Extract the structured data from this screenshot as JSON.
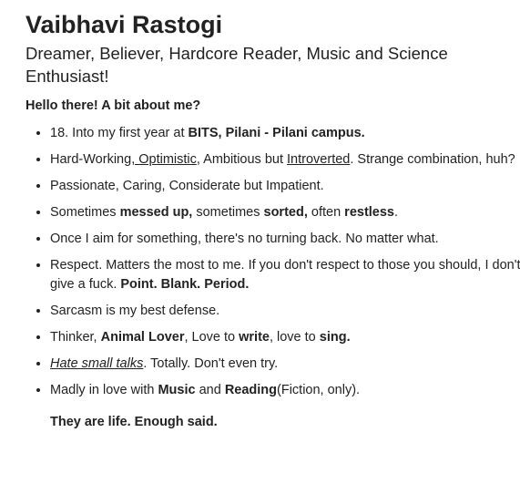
{
  "profile": {
    "name": "Vaibhavi Rastogi",
    "tagline": "Dreamer, Believer, Hardcore Reader, Music and Science Enthusiast!",
    "intro": "Hello there! A bit about me?",
    "closing": "They are life. Enough said."
  },
  "facts": {
    "f1": {
      "a": "18. Into my first year at ",
      "b": "BITS, Pilani - Pilani campus."
    },
    "f2": {
      "a": "Hard-Working",
      "b": ", Optimistic",
      "c": ", Ambitious but ",
      "d": "Introverted",
      "e": ". Strange combination, huh?"
    },
    "f3": {
      "a": "Passionate, Caring, Considerate but Impatient."
    },
    "f4": {
      "a": "Sometimes ",
      "b": "messed up,",
      "c": " sometimes ",
      "d": "sorted,",
      "e": " often ",
      "f": "restless",
      "g": "."
    },
    "f5": {
      "a": "Once I aim for something, there's no turning back. No matter what."
    },
    "f6": {
      "a": "Respect. Matters the most to me. If you don't respect to those you should, I don't give a fuck. ",
      "b": "Point. Blank. Period."
    },
    "f7": {
      "a": "Sarcasm is my best defense."
    },
    "f8": {
      "a": "Thinker, ",
      "b": "Animal Lover",
      "c": ", Love to ",
      "d": "write",
      "e": ", love to ",
      "f": "sing."
    },
    "f9": {
      "a": "Hate small talks",
      "b": ". Totally. Don't even try."
    },
    "f10": {
      "a": "Madly in love with ",
      "b": "Music",
      "c": " and ",
      "d": "Reading",
      "e": "(Fiction, only)."
    }
  }
}
